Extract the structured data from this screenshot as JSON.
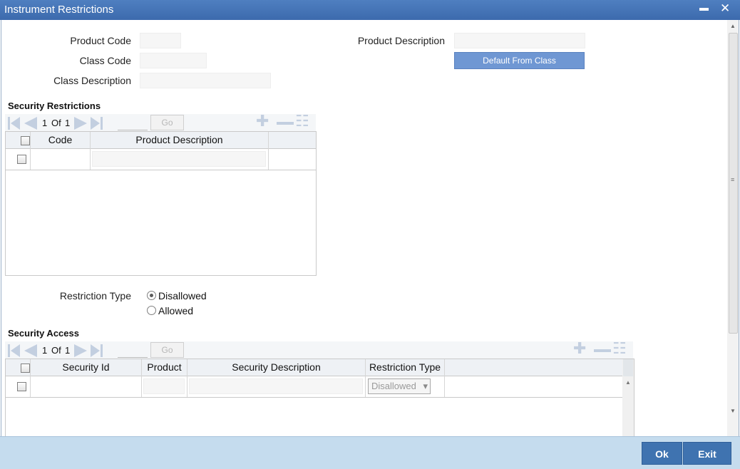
{
  "window": {
    "title": "Instrument Restrictions",
    "minimize_glyph": "▬",
    "close_glyph": "✕"
  },
  "header": {
    "product_code_label": "Product Code",
    "class_code_label": "Class Code",
    "class_description_label": "Class Description",
    "product_description_label": "Product Description",
    "default_from_class_label": "Default From Class",
    "product_code_value": "",
    "class_code_value": "",
    "class_description_value": "",
    "product_description_value": ""
  },
  "security_restrictions": {
    "title": "Security Restrictions",
    "nav": {
      "current_page": "1",
      "of_label": "Of",
      "total_pages": "1",
      "go_label": "Go"
    },
    "columns": [
      "Code",
      "Product Description"
    ],
    "rows": [
      {
        "code": "",
        "product_description": ""
      }
    ]
  },
  "restriction_type": {
    "label": "Restriction Type",
    "options": [
      "Disallowed",
      "Allowed"
    ],
    "selected": "Disallowed"
  },
  "security_access": {
    "title": "Security Access",
    "nav": {
      "current_page": "1",
      "of_label": "Of",
      "total_pages": "1",
      "go_label": "Go"
    },
    "columns": [
      "Security Id",
      "Product",
      "Security Description",
      "Restriction Type"
    ],
    "rows": [
      {
        "security_id": "",
        "product": "",
        "security_description": "",
        "restriction_type": "Disallowed"
      }
    ]
  },
  "footer": {
    "ok_label": "Ok",
    "exit_label": "Exit"
  },
  "colors": {
    "titlebar": "#3c6aad",
    "accent_button": "#6f97d3",
    "footer_bg": "#c5dcee",
    "footer_button": "#3f73b0",
    "nav_icon": "#c3cfe0"
  }
}
